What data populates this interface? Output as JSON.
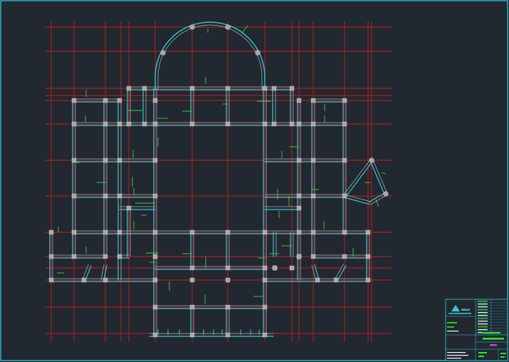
{
  "viewport": {
    "background": "#212830",
    "frame_color": "#2fd0e0"
  },
  "drawing": {
    "grid_color": "#c81e1e",
    "wall_color": "#38c9d6",
    "wall_core_color": "#9fb0b8",
    "column_color": "#a8a8a8",
    "dimension_color": "#38d838"
  },
  "title_block": {
    "logo_text": "SHUZI",
    "accent_green": "#2ee82e",
    "accent_magenta": "#e03ad0"
  }
}
